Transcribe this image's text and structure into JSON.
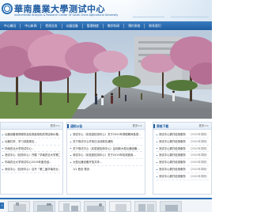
{
  "header": {
    "title": "華南農業大學测试中心",
    "subtitle": "Instrumental Analysis & Research Center Of South China Agricultural University"
  },
  "nav": {
    "items": [
      "中心概况",
      "中心新闻",
      "检测业务",
      "仪器设备",
      "管理制度",
      "教学科研",
      "预约系统",
      "联系我们"
    ]
  },
  "colors": {
    "brand": "#1d5aa0",
    "nav": "#2a6fb4",
    "panel_border": "#cfd9e6"
  },
  "news": {
    "title": "中心新闻",
    "more": "更多>>",
    "items": [
      "仪器设备维修服务及检测费用相关项目和价格...",
      "仪器共享、学习讲座报名...",
      "华南农业大学测试中心...",
      "测试中心（检测中心）开展「华南农业大学第二...",
      "华南农业大学测试中心2019年度总结...",
      "测试中心（检测中心）召开「第二届华南农业..."
    ]
  },
  "notices": {
    "title": "通知公告",
    "more": "更多>>",
    "items": [
      "测试中心（实验室检测中心）关于2020年寒假期间各类...",
      "关于测试中心开放日活动报名通知",
      "关于测试中心（实验室检测中心）启用新大型仪器设备...",
      "测试中心（实验室检测中心）关于2019年检测费用...",
      "大型仪器设备开放共享..."
    ],
    "pagination": "1/1  首页 尾页"
  },
  "downloads": {
    "title": "表格下载",
    "more": "更多>>",
    "items": [
      {
        "text": "测试中心委托检测服务",
        "date": "（2020年寒假）"
      },
      {
        "text": "测试中心委托检测服务",
        "date": "（2020年寒假）"
      },
      {
        "text": "测试中心委托检测服务",
        "date": "（2020年寒假）"
      },
      {
        "text": "测试中心委托检测服务",
        "date": "（2020年寒假）"
      },
      {
        "text": "测试中心委托检测服务",
        "date": "（2020年寒假）"
      },
      {
        "text": "测试中心委托检测服务",
        "date": "（2020年寒假）"
      },
      {
        "text": "测试中心委托检测服务",
        "date": "（2020年寒假）"
      }
    ]
  },
  "strip": {
    "arrow": "‹"
  }
}
